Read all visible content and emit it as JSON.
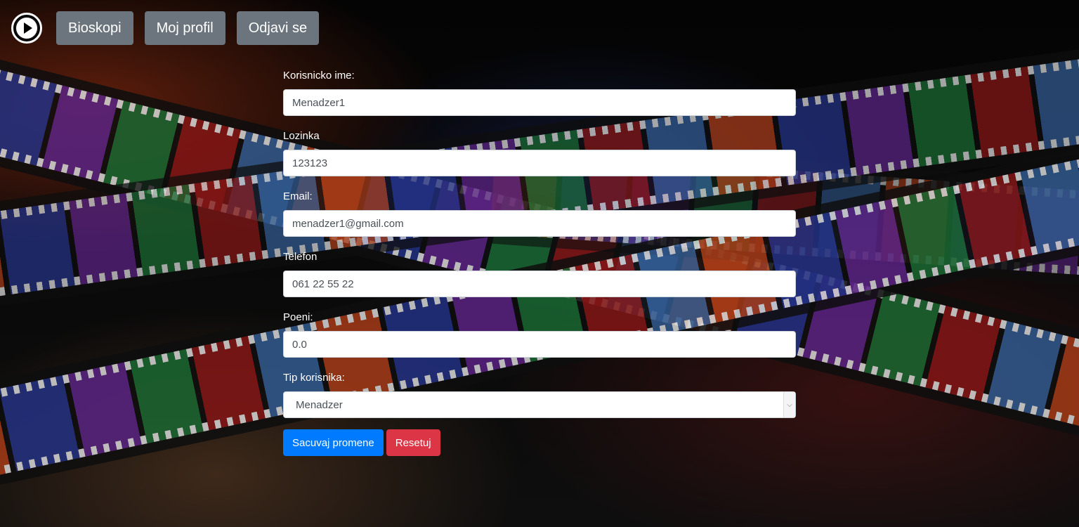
{
  "nav": {
    "items": [
      {
        "label": "Bioskopi"
      },
      {
        "label": "Moj profil"
      },
      {
        "label": "Odjavi se"
      }
    ]
  },
  "form": {
    "username": {
      "label": "Korisnicko ime:",
      "value": "Menadzer1"
    },
    "password": {
      "label": "Lozinka",
      "value": "123123"
    },
    "email": {
      "label": "Email:",
      "value": "menadzer1@gmail.com"
    },
    "phone": {
      "label": "Telefon",
      "value": "061 22 55 22"
    },
    "points": {
      "label": "Poeni:",
      "value": "0.0"
    },
    "user_type": {
      "label": "Tip korisnika:",
      "value": "Menadzer"
    },
    "save_label": "Sacuvaj promene",
    "reset_label": "Resetuj"
  },
  "colors": {
    "nav_button": "#6c757d",
    "primary": "#007bff",
    "danger": "#dc3545"
  },
  "icons": {
    "logo": "play-circle-icon",
    "select_arrow": "chevron-down-icon"
  }
}
